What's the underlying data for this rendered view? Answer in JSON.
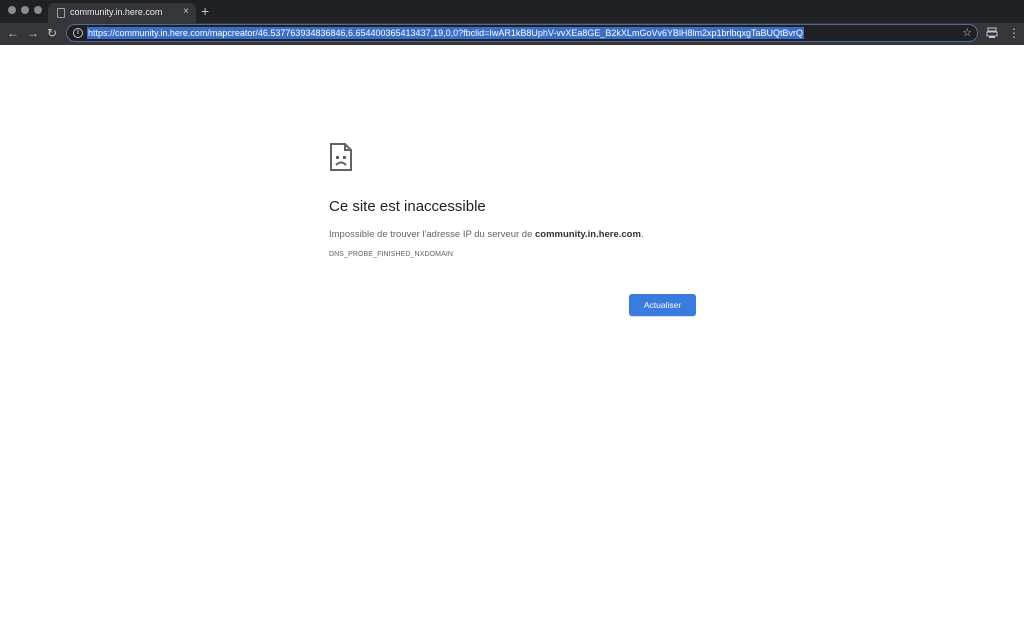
{
  "browser": {
    "tab": {
      "title": "community.in.here.com",
      "close_glyph": "×"
    },
    "new_tab_glyph": "+",
    "nav": {
      "back_glyph": "←",
      "forward_glyph": "→",
      "reload_glyph": "↻"
    },
    "address_bar": {
      "url": "https://community.in.here.com/mapcreator/46.537763934836846,6.654400365413437,19,0,0?fbclid=IwAR1kB8UphV-vvXEa8GE_B2kXLmGoVv6YBlH8lm2xp1brlbqxgTaBUQtBvrQ",
      "info_glyph": "i",
      "star_glyph": "☆"
    },
    "menu_glyph": "⋮",
    "colors": {
      "titlebar": "#202124",
      "toolbar": "#35363a",
      "url_selection": "#3b6ec8"
    }
  },
  "error_page": {
    "icon": "sad-page-icon",
    "title": "Ce site est inaccessible",
    "description_prefix": "Impossible de trouver l'adresse IP du serveur de ",
    "description_host": "community.in.here.com",
    "description_suffix": ".",
    "error_code": "DNS_PROBE_FINISHED_NXDOMAIN",
    "reload_label": "Actualiser",
    "colors": {
      "button": "#3a7be0"
    }
  }
}
